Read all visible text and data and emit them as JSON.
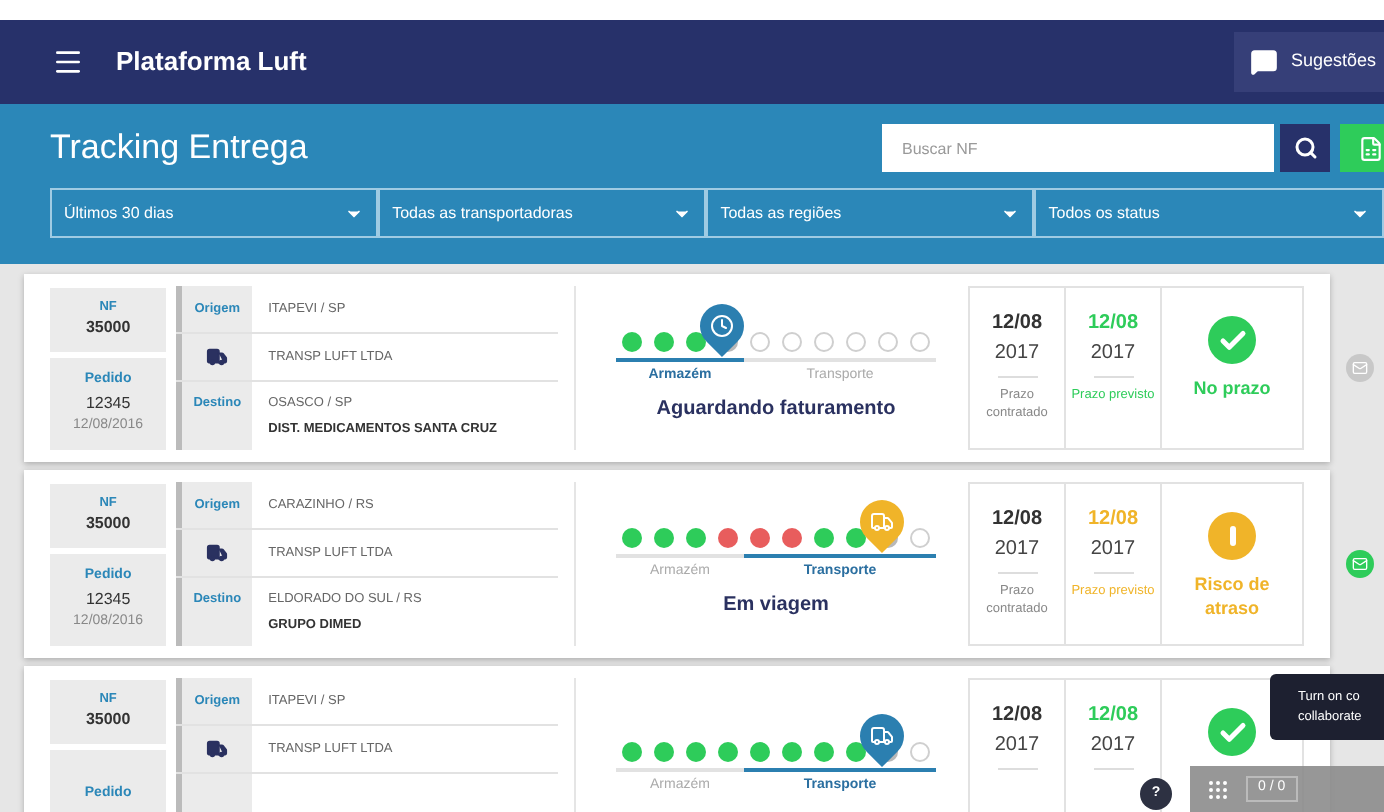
{
  "header": {
    "title": "Plataforma Luft",
    "suggestions_button": "Sugestões"
  },
  "toolbar": {
    "title": "Tracking Entrega",
    "search": {
      "placeholder": "Buscar NF"
    },
    "filters": [
      "Últimos 30 dias",
      "Todas as transportadoras",
      "Todas as regiões",
      "Todos os status"
    ]
  },
  "shipments": [
    {
      "nf_label": "NF",
      "nf": "35000",
      "order_label": "Pedido",
      "order": "12345",
      "date": "12/08/2016",
      "origin_label": "Origem",
      "origin": "ITAPEVI / SP",
      "carrier": "TRANSP LUFT LTDA",
      "destination_label": "Destino",
      "destination": "OSASCO / SP",
      "recipient": "DIST. MEDICAMENTOS SANTA CRUZ",
      "pin": {
        "kind": "clock",
        "color": "#2b7fb0"
      },
      "stages": [
        {
          "label": "Armazém",
          "selected": true,
          "steps": [
            {
              "kind": "done"
            },
            {
              "kind": "done"
            },
            {
              "kind": "done"
            },
            {
              "kind": "current"
            }
          ]
        },
        {
          "label": "Transporte",
          "selected": false,
          "steps": [
            {
              "kind": "pending"
            },
            {
              "kind": "pending"
            },
            {
              "kind": "pending"
            },
            {
              "kind": "pending"
            },
            {
              "kind": "pending"
            },
            {
              "kind": "pending"
            }
          ]
        }
      ],
      "status_text": "Aguardando faturamento",
      "contracted_date": "12/08",
      "contracted_year": "2017",
      "contracted_label": "Prazo contratado",
      "expected_date": "12/08",
      "expected_year": "2017",
      "expected_label": "Prazo previsto",
      "status": {
        "kind": "on_time",
        "text": "No prazo"
      },
      "message_active": false
    },
    {
      "nf_label": "NF",
      "nf": "35000",
      "order_label": "Pedido",
      "order": "12345",
      "date": "12/08/2016",
      "origin_label": "Origem",
      "origin": "CARAZINHO / RS",
      "carrier": "TRANSP LUFT LTDA",
      "destination_label": "Destino",
      "destination": "ELDORADO DO SUL / RS",
      "recipient": "GRUPO DIMED",
      "pin": {
        "kind": "truck",
        "color": "#f0b429"
      },
      "stages": [
        {
          "label": "Armazém",
          "selected": false,
          "steps": [
            {
              "kind": "done"
            },
            {
              "kind": "done"
            },
            {
              "kind": "done"
            },
            {
              "kind": "late"
            }
          ]
        },
        {
          "label": "Transporte",
          "selected": true,
          "steps": [
            {
              "kind": "late"
            },
            {
              "kind": "late"
            },
            {
              "kind": "done"
            },
            {
              "kind": "done"
            },
            {
              "kind": "current"
            },
            {
              "kind": "pending"
            }
          ]
        }
      ],
      "status_text": "Em viagem",
      "contracted_date": "12/08",
      "contracted_year": "2017",
      "contracted_label": "Prazo contratado",
      "expected_date": "12/08",
      "expected_year": "2017",
      "expected_label": "Prazo previsto",
      "status": {
        "kind": "at_risk",
        "text": "Risco de atraso"
      },
      "message_active": true
    },
    {
      "nf_label": "NF",
      "nf": "35000",
      "order_label": "Pedido",
      "origin_label": "Origem",
      "origin": "ITAPEVI / SP",
      "carrier": "TRANSP LUFT LTDA",
      "pin": {
        "kind": "truck",
        "color": "#2b7fb0"
      },
      "stages": [
        {
          "label": "Armazém",
          "selected": false,
          "steps": [
            {
              "kind": "done"
            },
            {
              "kind": "done"
            },
            {
              "kind": "done"
            },
            {
              "kind": "done"
            }
          ]
        },
        {
          "label": "Transporte",
          "selected": true,
          "steps": [
            {
              "kind": "done"
            },
            {
              "kind": "done"
            },
            {
              "kind": "done"
            },
            {
              "kind": "done"
            },
            {
              "kind": "current"
            },
            {
              "kind": "pending"
            }
          ]
        }
      ],
      "contracted_date": "12/08",
      "contracted_year": "2017",
      "expected_date": "12/08",
      "expected_year": "2017",
      "status": {
        "kind": "on_time"
      }
    }
  ],
  "tooltip": [
    "Turn on co",
    "collaborate"
  ],
  "help_button": "?",
  "counter": "0 / 0"
}
